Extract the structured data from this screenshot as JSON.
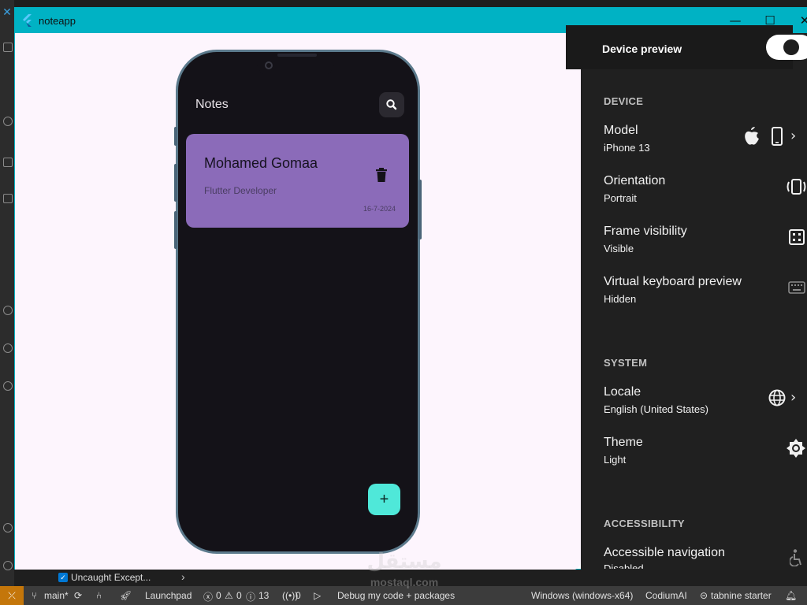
{
  "window": {
    "title": "noteapp",
    "controls": {
      "minimize": "—",
      "maximize": "☐",
      "close": "✕"
    }
  },
  "app": {
    "title": "Notes",
    "notes": [
      {
        "title": "Mohamed Gomaa",
        "subtitle": "Flutter Developer",
        "date": "16-7-2024"
      }
    ],
    "fab_label": "+"
  },
  "device_preview": {
    "header": "Device preview",
    "enabled": true,
    "sections": {
      "device": "DEVICE",
      "system": "SYSTEM",
      "accessibility": "ACCESSIBILITY"
    },
    "model": {
      "title": "Model",
      "value": "iPhone 13"
    },
    "orientation": {
      "title": "Orientation",
      "value": "Portrait"
    },
    "frame": {
      "title": "Frame visibility",
      "value": "Visible"
    },
    "keyboard": {
      "title": "Virtual keyboard preview",
      "value": "Hidden"
    },
    "locale": {
      "title": "Locale",
      "value": "English (United States)"
    },
    "theme": {
      "title": "Theme",
      "value": "Light"
    },
    "accessible_nav": {
      "title": "Accessible navigation",
      "value": "Disabled"
    }
  },
  "panel": {
    "exception_label": "Uncaught Except...",
    "exception_checked": true
  },
  "status_bar": {
    "branch": "main*",
    "launchpad": "Launchpad",
    "errors": "0",
    "warnings": "0",
    "infos": "13",
    "ports": "0",
    "debug": "Debug my code + packages",
    "platform": "Windows (windows-x64)",
    "codium": "CodiumAI",
    "tabnine": "tabnine starter"
  },
  "watermark": {
    "arabic": "مستقل",
    "latin": "mostaql.com"
  },
  "colors": {
    "titlebar": "#00b2c4",
    "note_card": "#8b6bb9",
    "fab": "#4fe8d9",
    "phone_screen": "#141218",
    "panel_bg": "#202020",
    "status_remote": "#c4760a"
  }
}
